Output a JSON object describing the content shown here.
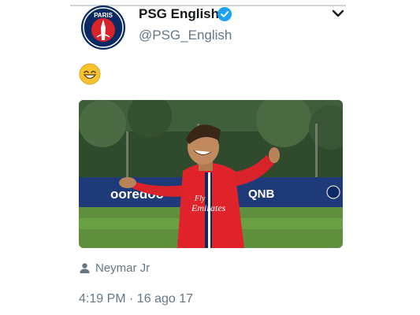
{
  "tweet": {
    "display_name": "PSG English",
    "handle": "@PSG_English",
    "verified": true,
    "avatar_text": "PARIS",
    "body_emoji": "grinning-smiling-eyes",
    "tagged_person": "Neymar Jr",
    "timestamp": "4:19 PM · 16 ago 17"
  },
  "photo": {
    "jersey_sponsor_line1": "Fly",
    "jersey_sponsor_line2": "Emirates",
    "board_left": "ooredoo",
    "board_right": "QNB"
  },
  "colors": {
    "text_primary": "#14171a",
    "text_secondary": "#657786",
    "verified_blue": "#1da1f2",
    "psg_navy": "#0b2a63",
    "psg_red": "#e0232b"
  },
  "icons": [
    "verified-badge-icon",
    "chevron-down-icon",
    "person-tag-icon"
  ]
}
